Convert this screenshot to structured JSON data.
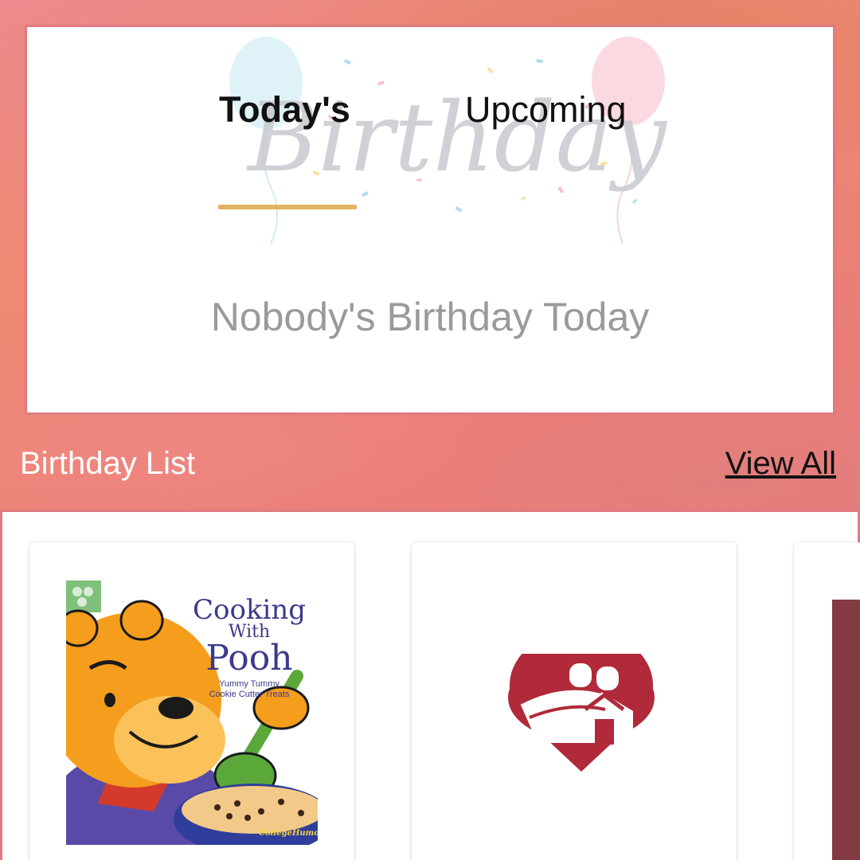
{
  "tabs": {
    "today_label": "Today's",
    "upcoming_label": "Upcoming",
    "active": "today"
  },
  "today": {
    "empty_message": "Nobody's Birthday Today",
    "decoration_text": "Birthday"
  },
  "birthday_list": {
    "title": "Birthday List",
    "view_all_label": "View All",
    "cards": [
      {
        "image": "book-cover-cooking-with-pooh",
        "cover_title_line1": "Cooking",
        "cover_title_line2": "With",
        "cover_title_line3": "Pooh",
        "cover_subtitle": "Yummy Tummy Cookie Cutter Treats",
        "cover_brand": "CollegeHumor"
      },
      {
        "image": "barn-location-logo"
      },
      {
        "image": "partial-dark-image"
      }
    ]
  },
  "colors": {
    "accent_underline": "#e0b463",
    "border": "#e07a80",
    "logo_red": "#b02a3a"
  }
}
